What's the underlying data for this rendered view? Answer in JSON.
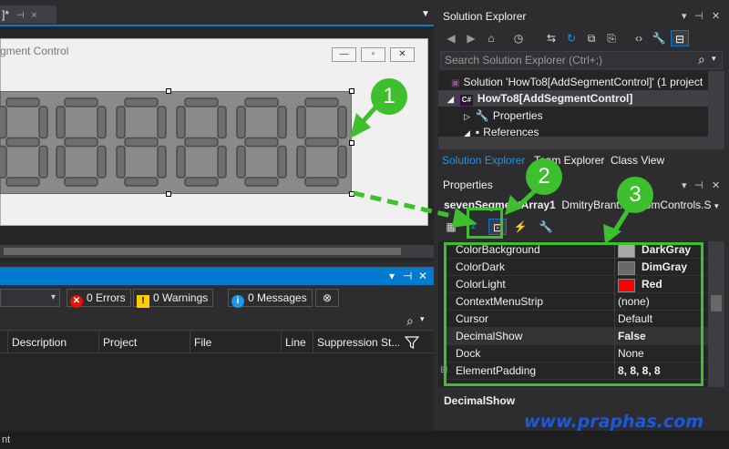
{
  "document": {
    "tab_label": "]*",
    "tab_close_icon": "×",
    "form_title": "gment Control"
  },
  "segments": {
    "value_display": "8888888"
  },
  "error_list": {
    "scope_icon": "▾",
    "errors_label": "0 Errors",
    "warnings_label": "0 Warnings",
    "messages_label": "0 Messages",
    "columns": [
      "Description",
      "Project",
      "File",
      "Line",
      "Suppression St..."
    ],
    "search_icon": "⌕"
  },
  "status_bar": {
    "text": "nt"
  },
  "solution_explorer": {
    "title": "Solution Explorer",
    "search_placeholder": "Search Solution Explorer (Ctrl+;)",
    "tree": [
      {
        "label": "Solution 'HowTo8[AddSegmentControl]' (1 project",
        "bold": false
      },
      {
        "label": "HowTo8[AddSegmentControl]",
        "bold": true
      },
      {
        "label": "Properties",
        "bold": false
      },
      {
        "label": "References",
        "bold": false
      }
    ],
    "tabs": [
      "Solution Explorer",
      "Team Explorer",
      "Class View"
    ]
  },
  "properties": {
    "title": "Properties",
    "object_name": "sevenSegmentArray1",
    "object_type": "DmitryBrant.CustomControls.S",
    "rows": [
      {
        "name": "ColorBackground",
        "value": "DarkGray",
        "swatch": "#a9a9a9",
        "bold": true
      },
      {
        "name": "ColorDark",
        "value": "DimGray",
        "swatch": "#696969",
        "bold": true
      },
      {
        "name": "ColorLight",
        "value": "Red",
        "swatch": "#ff0000",
        "bold": true
      },
      {
        "name": "ContextMenuStrip",
        "value": "(none)",
        "swatch": null,
        "bold": false
      },
      {
        "name": "Cursor",
        "value": "Default",
        "swatch": null,
        "bold": false
      },
      {
        "name": "DecimalShow",
        "value": "False",
        "swatch": null,
        "bold": true
      },
      {
        "name": "Dock",
        "value": "None",
        "swatch": null,
        "bold": false
      },
      {
        "name": "ElementPadding",
        "value": "8, 8, 8, 8",
        "swatch": null,
        "bold": true
      }
    ],
    "description_title": "DecimalShow"
  },
  "callouts": [
    "1",
    "2",
    "3"
  ],
  "watermark": "www.praphas.com",
  "colors": {
    "accent": "#007acc",
    "callout_green": "#3dbf2e",
    "watermark_blue": "#1e58d6"
  }
}
